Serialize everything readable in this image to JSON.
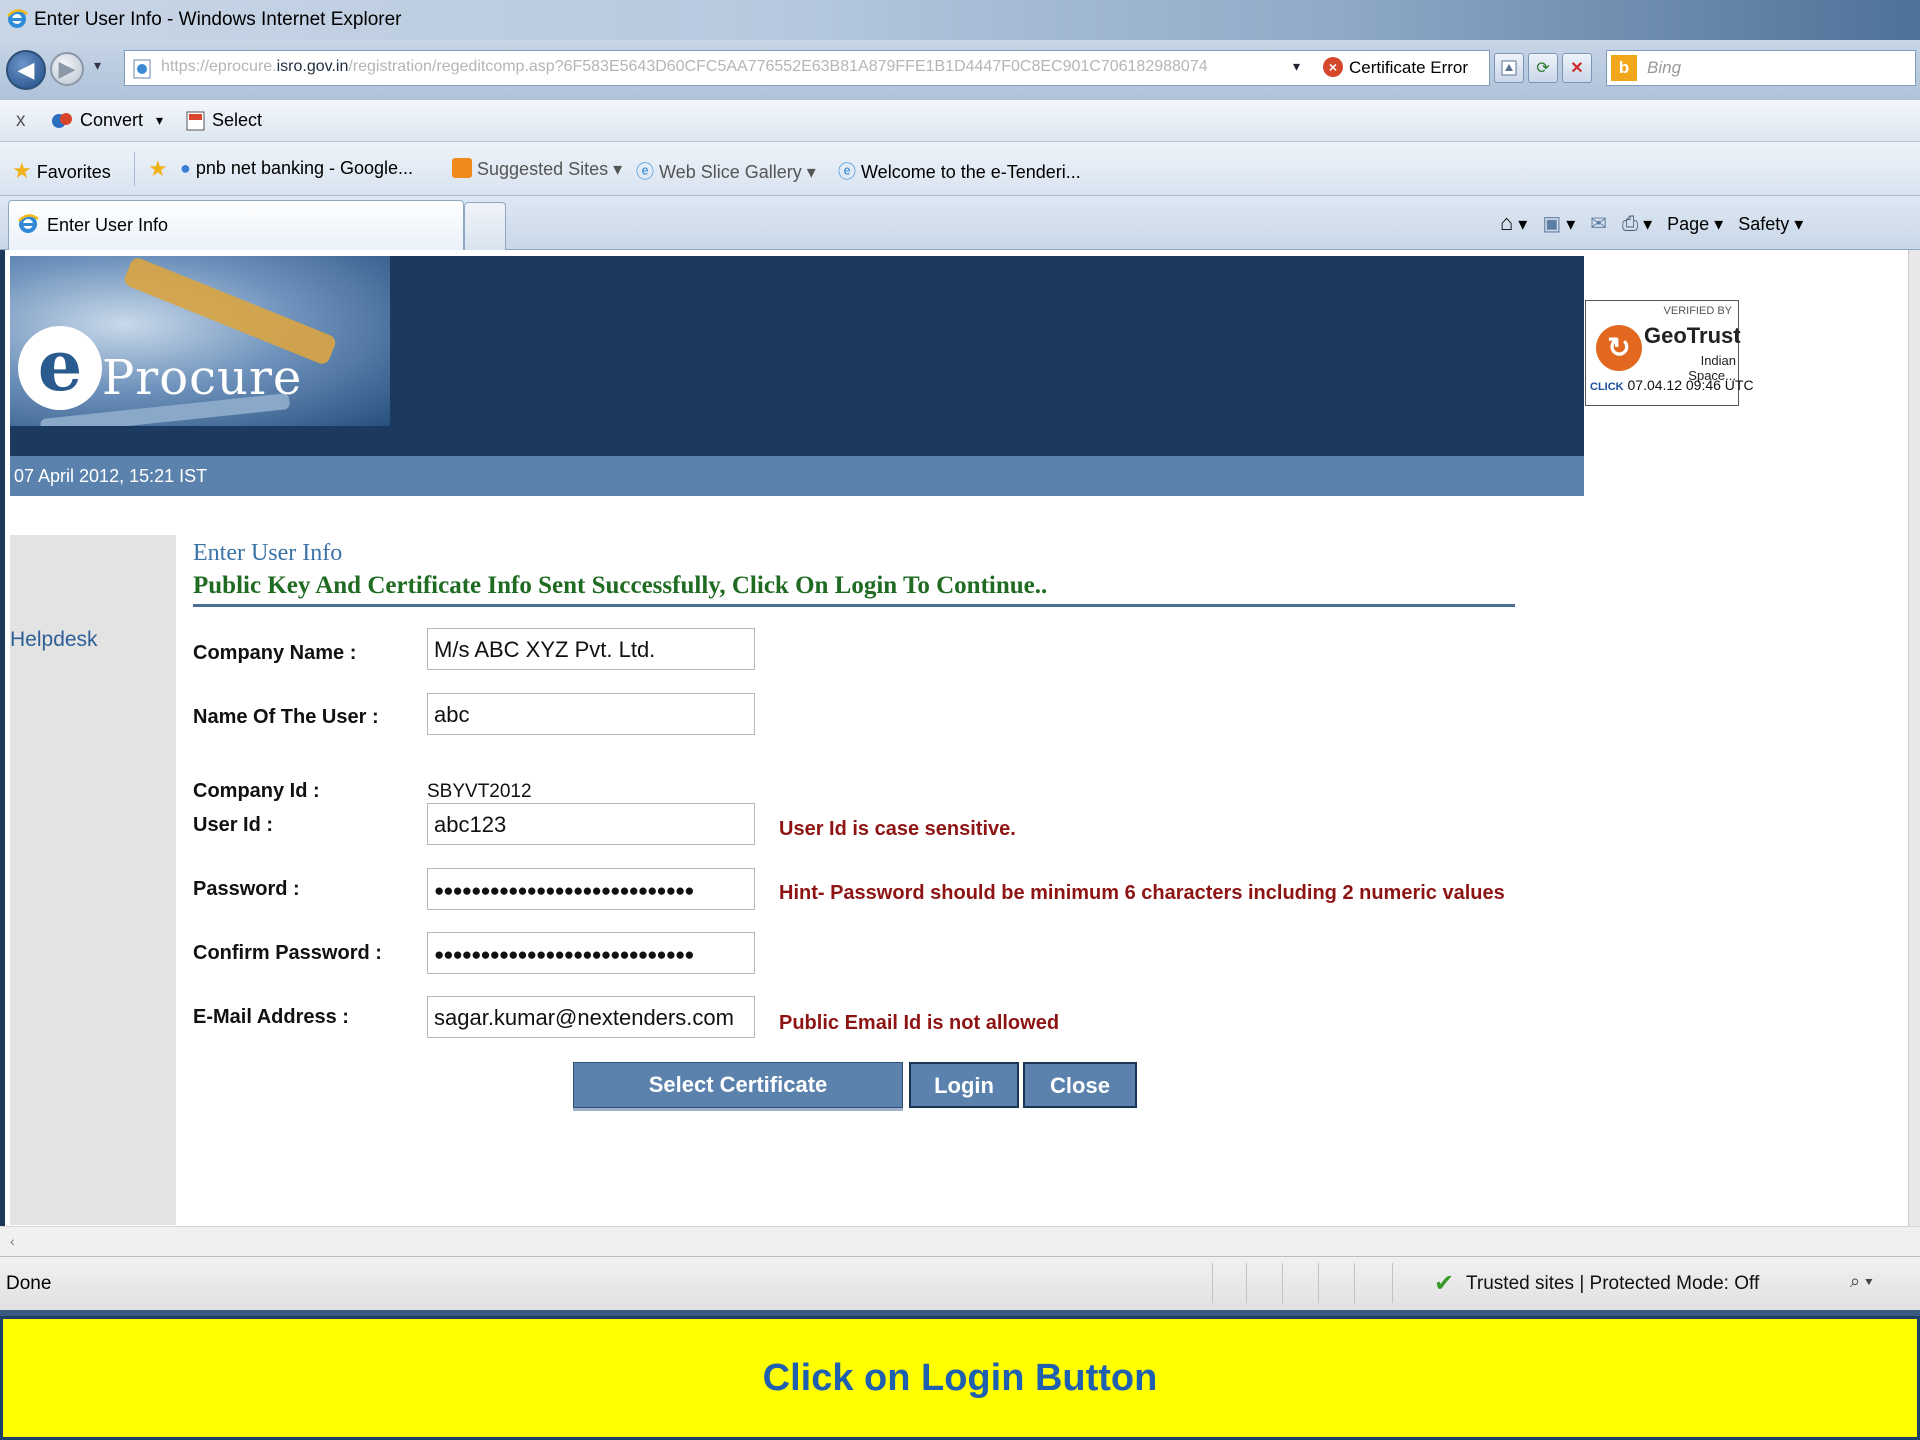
{
  "window": {
    "title": "Enter User Info - Windows Internet Explorer"
  },
  "address_bar": {
    "url_prefix": "https://eprocure.",
    "url_domain": "isro.gov.in",
    "url_path": "/registration/regeditcomp.asp?6F583E5643D60CFC5AA776552E63B81A879FFE1B1D4447F0C8EC901C706182988074",
    "certificate": "Certificate Error",
    "search_placeholder": "Bing"
  },
  "toolbar": {
    "close": "x",
    "convert": "Convert",
    "select": "Select"
  },
  "favorites": {
    "label": "Favorites",
    "items": [
      "pnb net banking - Google...",
      "Suggested Sites ▾",
      "Web Slice Gallery ▾",
      "Welcome to the e-Tenderi..."
    ]
  },
  "tabs": {
    "active": "Enter User Info"
  },
  "command_bar": {
    "page": "Page ▾",
    "safety": "Safety ▾"
  },
  "banner": {
    "logo_letter": "e",
    "logo_rest": "Procure",
    "date": "07 April 2012,  15:21  IST"
  },
  "geotrust": {
    "verified": "VERIFIED BY",
    "brand": "GeoTrust",
    "company": "Indian Space...",
    "click_label": "CLICK",
    "timestamp": "07.04.12 09:46 UTC"
  },
  "sidebar": {
    "helpdesk": "Helpdesk"
  },
  "form": {
    "title": "Enter User Info",
    "message": "Public Key And Certificate Info Sent Successfully, Click On Login To Continue..",
    "company_name_label": "Company Name :",
    "company_name_value": "M/s ABC XYZ Pvt. Ltd.",
    "user_name_label": "Name Of The User :",
    "user_name_value": "abc",
    "company_id_label": "Company Id :",
    "company_id_value": "SBYVT2012",
    "user_id_label": "User Id :",
    "user_id_value": "abc123",
    "user_id_note": "User Id is case sensitive.",
    "password_label": "Password :",
    "password_value": "●●●●●●●●●●●●●●●●●●●●●●●●●●●●",
    "password_hint": "Hint-  Password should be minimum 6 characters including 2 numeric values",
    "confirm_password_label": "Confirm Password :",
    "confirm_password_value": "●●●●●●●●●●●●●●●●●●●●●●●●●●●●",
    "email_label": "E-Mail Address :",
    "email_value": "sagar.kumar@nextenders.com",
    "email_note": "Public Email Id is not allowed"
  },
  "buttons": {
    "select_certificate": "Select Certificate",
    "login": "Login",
    "close": "Close"
  },
  "status_bar": {
    "status": "Done",
    "zone": "Trusted sites | Protected Mode: Off"
  },
  "caption": {
    "text": "Click on Login Button"
  },
  "colors": {
    "banner": "#1c3a60",
    "button": "#5a82ad",
    "message_green": "#1f6b22",
    "note_red": "#8e1414",
    "caption_bg": "#ffff00",
    "caption_text": "#1f5fb0"
  }
}
